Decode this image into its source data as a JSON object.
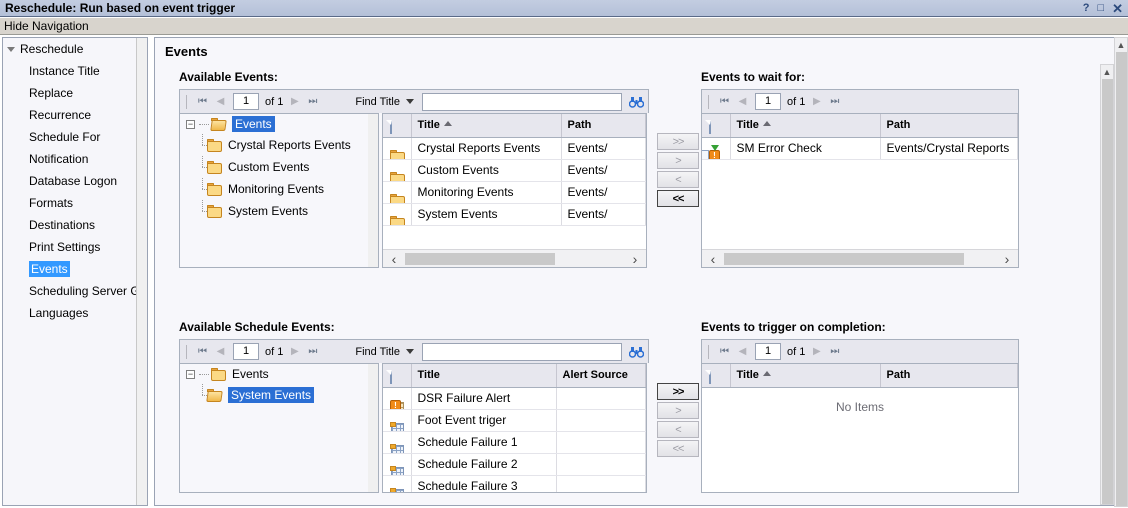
{
  "window": {
    "title": "Reschedule: Run based on event trigger",
    "help_label": "?",
    "maximize_label": "□",
    "close_label": "✕"
  },
  "hide_navigation_label": "Hide Navigation",
  "sidebar": {
    "root_label": "Reschedule",
    "items": [
      {
        "label": "Instance Title",
        "selected": false
      },
      {
        "label": "Replace",
        "selected": false
      },
      {
        "label": "Recurrence",
        "selected": false
      },
      {
        "label": "Schedule For",
        "selected": false
      },
      {
        "label": "Notification",
        "selected": false
      },
      {
        "label": "Database Logon",
        "selected": false
      },
      {
        "label": "Formats",
        "selected": false
      },
      {
        "label": "Destinations",
        "selected": false
      },
      {
        "label": "Print Settings",
        "selected": false
      },
      {
        "label": "Events",
        "selected": true
      },
      {
        "label": "Scheduling Server Gr",
        "selected": false
      },
      {
        "label": "Languages",
        "selected": false
      }
    ]
  },
  "main": {
    "title": "Events"
  },
  "available_events": {
    "label": "Available Events:",
    "pager": {
      "first": "▏◀",
      "prev": "◀",
      "page": "1",
      "of": "of 1",
      "next": "▶",
      "last": "▶▕",
      "find_label": "Find Title",
      "find_value": "",
      "find_placeholder": ""
    },
    "tree": {
      "root": "Events",
      "root_selected": true,
      "children": [
        {
          "label": "Crystal Reports Events",
          "selected": false
        },
        {
          "label": "Custom Events",
          "selected": false
        },
        {
          "label": "Monitoring Events",
          "selected": false
        },
        {
          "label": "System Events",
          "selected": false
        }
      ]
    },
    "table": {
      "columns": [
        "Title",
        "Path"
      ],
      "sorted_column": "Title",
      "sort_direction": "asc",
      "rows": [
        {
          "icon": "folder-icon",
          "title": "Crystal Reports Events",
          "path": "Events/"
        },
        {
          "icon": "folder-icon",
          "title": "Custom Events",
          "path": "Events/"
        },
        {
          "icon": "folder-icon",
          "title": "Monitoring Events",
          "path": "Events/"
        },
        {
          "icon": "folder-icon",
          "title": "System Events",
          "path": "Events/"
        }
      ]
    }
  },
  "events_to_wait_for": {
    "label": "Events to wait for:",
    "pager": {
      "page": "1",
      "of": "of 1"
    },
    "table": {
      "columns": [
        "Title",
        "Path"
      ],
      "sorted_column": "Title",
      "sort_direction": "asc",
      "rows": [
        {
          "icon": "event-alert-icon",
          "title": "SM Error Check",
          "path": "Events/Crystal Reports"
        }
      ]
    }
  },
  "available_schedule_events": {
    "label": "Available Schedule Events:",
    "pager": {
      "page": "1",
      "of": "of 1",
      "find_label": "Find Title",
      "find_value": "",
      "find_placeholder": ""
    },
    "tree": {
      "root": "Events",
      "root_selected": false,
      "children": [
        {
          "label": "System Events",
          "selected": true
        }
      ]
    },
    "table": {
      "columns": [
        "Title",
        "Alert Source"
      ],
      "rows": [
        {
          "icon": "alert-event-icon",
          "title": "DSR Failure Alert",
          "alert_source": ""
        },
        {
          "icon": "schedule-event-icon",
          "title": "Foot Event triger",
          "alert_source": ""
        },
        {
          "icon": "schedule-event-icon",
          "title": "Schedule Failure 1",
          "alert_source": ""
        },
        {
          "icon": "schedule-event-icon",
          "title": "Schedule Failure 2",
          "alert_source": ""
        },
        {
          "icon": "schedule-event-icon",
          "title": "Schedule Failure 3",
          "alert_source": ""
        }
      ]
    }
  },
  "events_to_trigger": {
    "label": "Events to trigger on completion:",
    "pager": {
      "page": "1",
      "of": "of 1"
    },
    "table": {
      "columns": [
        "Title",
        "Path"
      ],
      "sorted_column": "Title",
      "sort_direction": "asc",
      "empty_message": "No Items",
      "rows": []
    }
  },
  "transfer_top": {
    "add_all": ">>",
    "add": ">",
    "remove": "<",
    "remove_all": "<<",
    "active": "remove_all"
  },
  "transfer_bottom": {
    "add_all": ">>",
    "add": ">",
    "remove": "<",
    "remove_all": "<<",
    "active": "add_all"
  },
  "colors": {
    "titlebar": "#b4c0d8",
    "selection": "#3399ff",
    "tree_selection": "#2b6fd4",
    "folder": "#fbd985",
    "accent_icon": "#2b6fd4"
  }
}
